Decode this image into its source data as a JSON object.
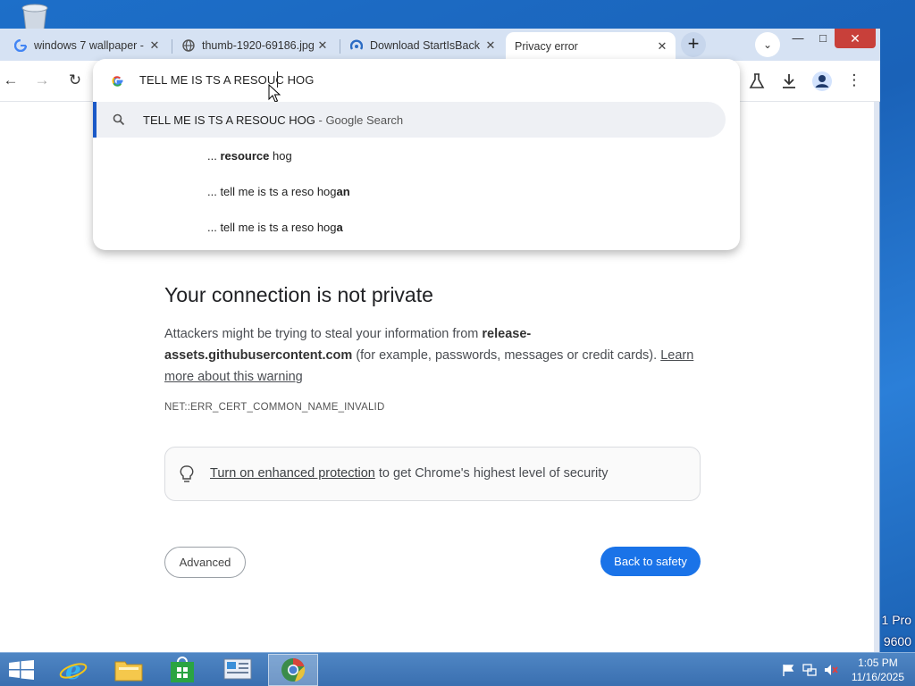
{
  "desktop": {
    "recycle_bin_icon": "recycle-bin-icon",
    "edge_text_1": "1 Pro",
    "edge_text_2": "9600"
  },
  "tabs": [
    {
      "title": "windows 7 wallpaper -",
      "favicon": "google-icon"
    },
    {
      "title": "thumb-1920-69186.jpg",
      "favicon": "globe-icon"
    },
    {
      "title": "Download StartIsBack",
      "favicon": "startisback-icon"
    },
    {
      "title": "Privacy error",
      "favicon": "none",
      "active": true
    }
  ],
  "window_controls": {
    "minimize": "—",
    "maximize": "□",
    "close": "✕"
  },
  "omnibox": {
    "typed": "TELL ME IS TS A RESOUC HOG",
    "suggestions": [
      {
        "query": "TELL ME IS TS A RESOUC HOG",
        "suffix": " - Google Search"
      },
      {
        "prefix": "... ",
        "bold": "resource",
        "rest": " hog"
      },
      {
        "prefix": "... tell me is ts a reso hog",
        "bold": "an",
        "rest": ""
      },
      {
        "prefix": "... tell me is ts a reso hog",
        "bold": "a",
        "rest": ""
      }
    ]
  },
  "error": {
    "title": "Your connection is not private",
    "body_1": "Attackers might be trying to steal your information from ",
    "domain": "release-assets.githubusercontent.com",
    "body_2": " (for example, passwords, messages or credit cards). ",
    "learn_more": "Learn more about this warning",
    "code": "NET::ERR_CERT_COMMON_NAME_INVALID",
    "protection_link": "Turn on enhanced protection",
    "protection_rest": " to get Chrome's highest level of security",
    "advanced_label": "Advanced",
    "back_label": "Back to safety"
  },
  "taskbar": {
    "apps": [
      "internet-explorer-icon",
      "file-explorer-icon",
      "store-icon",
      "control-panel-icon",
      "chrome-icon"
    ],
    "time": "1:05 PM",
    "date": "11/16/2025"
  },
  "colors": {
    "accent_blue": "#1a73e8",
    "close_red": "#c8403a",
    "highlight_bar": "#1a59c7"
  }
}
